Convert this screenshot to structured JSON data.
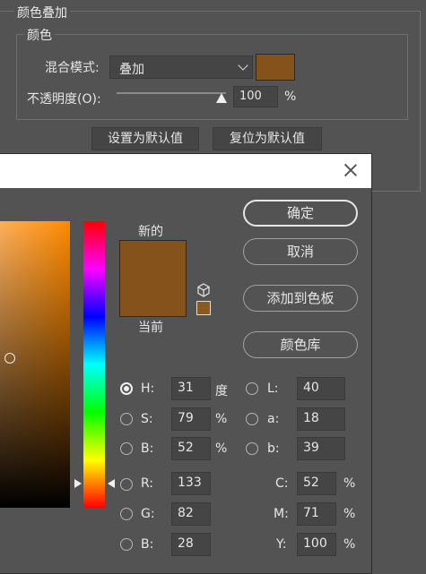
{
  "overlay_panel": {
    "section_title": "颜色叠加",
    "color_group_title": "颜色",
    "blend_mode_label": "混合模式:",
    "blend_mode_value": "叠加",
    "swatch_color": "#85521c",
    "opacity_label": "不透明度(O):",
    "opacity_value": "100",
    "opacity_unit": "%",
    "opacity_level_percent": 100,
    "set_default_label": "设置为默认值",
    "reset_default_label": "复位为默认值"
  },
  "picker": {
    "new_label": "新的",
    "current_label": "当前",
    "new_color": "#85521c",
    "current_color": "#85521c",
    "ok_label": "确定",
    "cancel_label": "取消",
    "add_swatch_label": "添加到色板",
    "libraries_label": "颜色库",
    "fields": {
      "H": {
        "label": "H:",
        "value": "31",
        "unit": "度"
      },
      "S": {
        "label": "S:",
        "value": "79",
        "unit": "%"
      },
      "B": {
        "label": "B:",
        "value": "52",
        "unit": "%"
      },
      "R": {
        "label": "R:",
        "value": "133"
      },
      "G": {
        "label": "G:",
        "value": "82"
      },
      "Bl": {
        "label": "B:",
        "value": "28"
      },
      "L": {
        "label": "L:",
        "value": "40"
      },
      "a": {
        "label": "a:",
        "value": "18"
      },
      "b": {
        "label": "b:",
        "value": "39"
      },
      "C": {
        "label": "C:",
        "value": "52",
        "unit": "%"
      },
      "M": {
        "label": "M:",
        "value": "71",
        "unit": "%"
      },
      "Y": {
        "label": "Y:",
        "value": "100",
        "unit": "%"
      }
    }
  }
}
